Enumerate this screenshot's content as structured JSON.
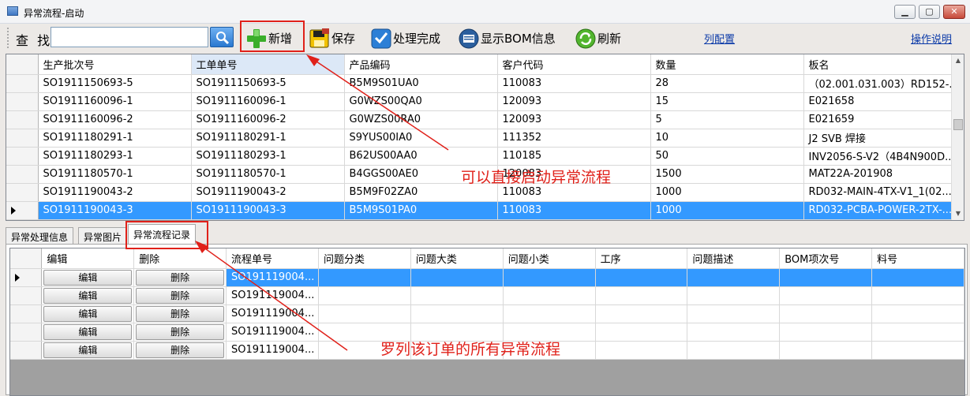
{
  "window": {
    "title": "异常流程-启动",
    "min_label": "▁",
    "max_label": "▢",
    "close_label": "✕"
  },
  "toolbar": {
    "find_label": "查 找",
    "find_value": "",
    "add_label": "新增",
    "save_label": "保存",
    "done_label": "处理完成",
    "bom_label": "显示BOM信息",
    "refresh_label": "刷新",
    "column_config_label": "列配置",
    "help_label": "操作说明"
  },
  "orders_grid": {
    "columns": [
      "生产批次号",
      "工单单号",
      "产品编码",
      "客户代码",
      "数量",
      "板名"
    ],
    "rows": [
      [
        "SO1911150693-5",
        "SO1911150693-5",
        "B5M9S01UA0",
        "110083",
        "28",
        "（02.001.031.003）RD152-..."
      ],
      [
        "SO1911160096-1",
        "SO1911160096-1",
        "G0WZS00QA0",
        "120093",
        "15",
        "E021658"
      ],
      [
        "SO1911160096-2",
        "SO1911160096-2",
        "G0WZS00RA0",
        "120093",
        "5",
        "E021659"
      ],
      [
        "SO1911180291-1",
        "SO1911180291-1",
        "S9YUS00IA0",
        "111352",
        "10",
        "J2 SVB 焊接"
      ],
      [
        "SO1911180293-1",
        "SO1911180293-1",
        "B62US00AA0",
        "110185",
        "50",
        "INV2056-S-V2（4B4N900D..."
      ],
      [
        "SO1911180570-1",
        "SO1911180570-1",
        "B4GGS00AE0",
        "120083",
        "1500",
        "MAT22A-201908"
      ],
      [
        "SO1911190043-2",
        "SO1911190043-2",
        "B5M9F02ZA0",
        "110083",
        "1000",
        "RD032-MAIN-4TX-V1_1(02...."
      ],
      [
        "SO1911190043-3",
        "SO1911190043-3",
        "B5M9S01PA0",
        "110083",
        "1000",
        "RD032-PCBA-POWER-2TX-..."
      ]
    ],
    "selected_row": 7
  },
  "tabs": [
    "异常处理信息",
    "异常图片",
    "异常流程记录"
  ],
  "active_tab": 2,
  "records_grid": {
    "columns": [
      "编辑",
      "删除",
      "流程单号",
      "问题分类",
      "问题大类",
      "问题小类",
      "工序",
      "问题描述",
      "BOM项次号",
      "料号"
    ],
    "edit_label": "编辑",
    "delete_label": "删除",
    "rows": [
      "SO191119004...",
      "SO191119004...",
      "SO191119004...",
      "SO191119004...",
      "SO191119004..."
    ],
    "selected_row": 0
  },
  "annotations": {
    "add_note": "可以直接启动异常流程",
    "records_note": "罗列该订单的所有异常流程",
    "color": "#e0211a"
  }
}
